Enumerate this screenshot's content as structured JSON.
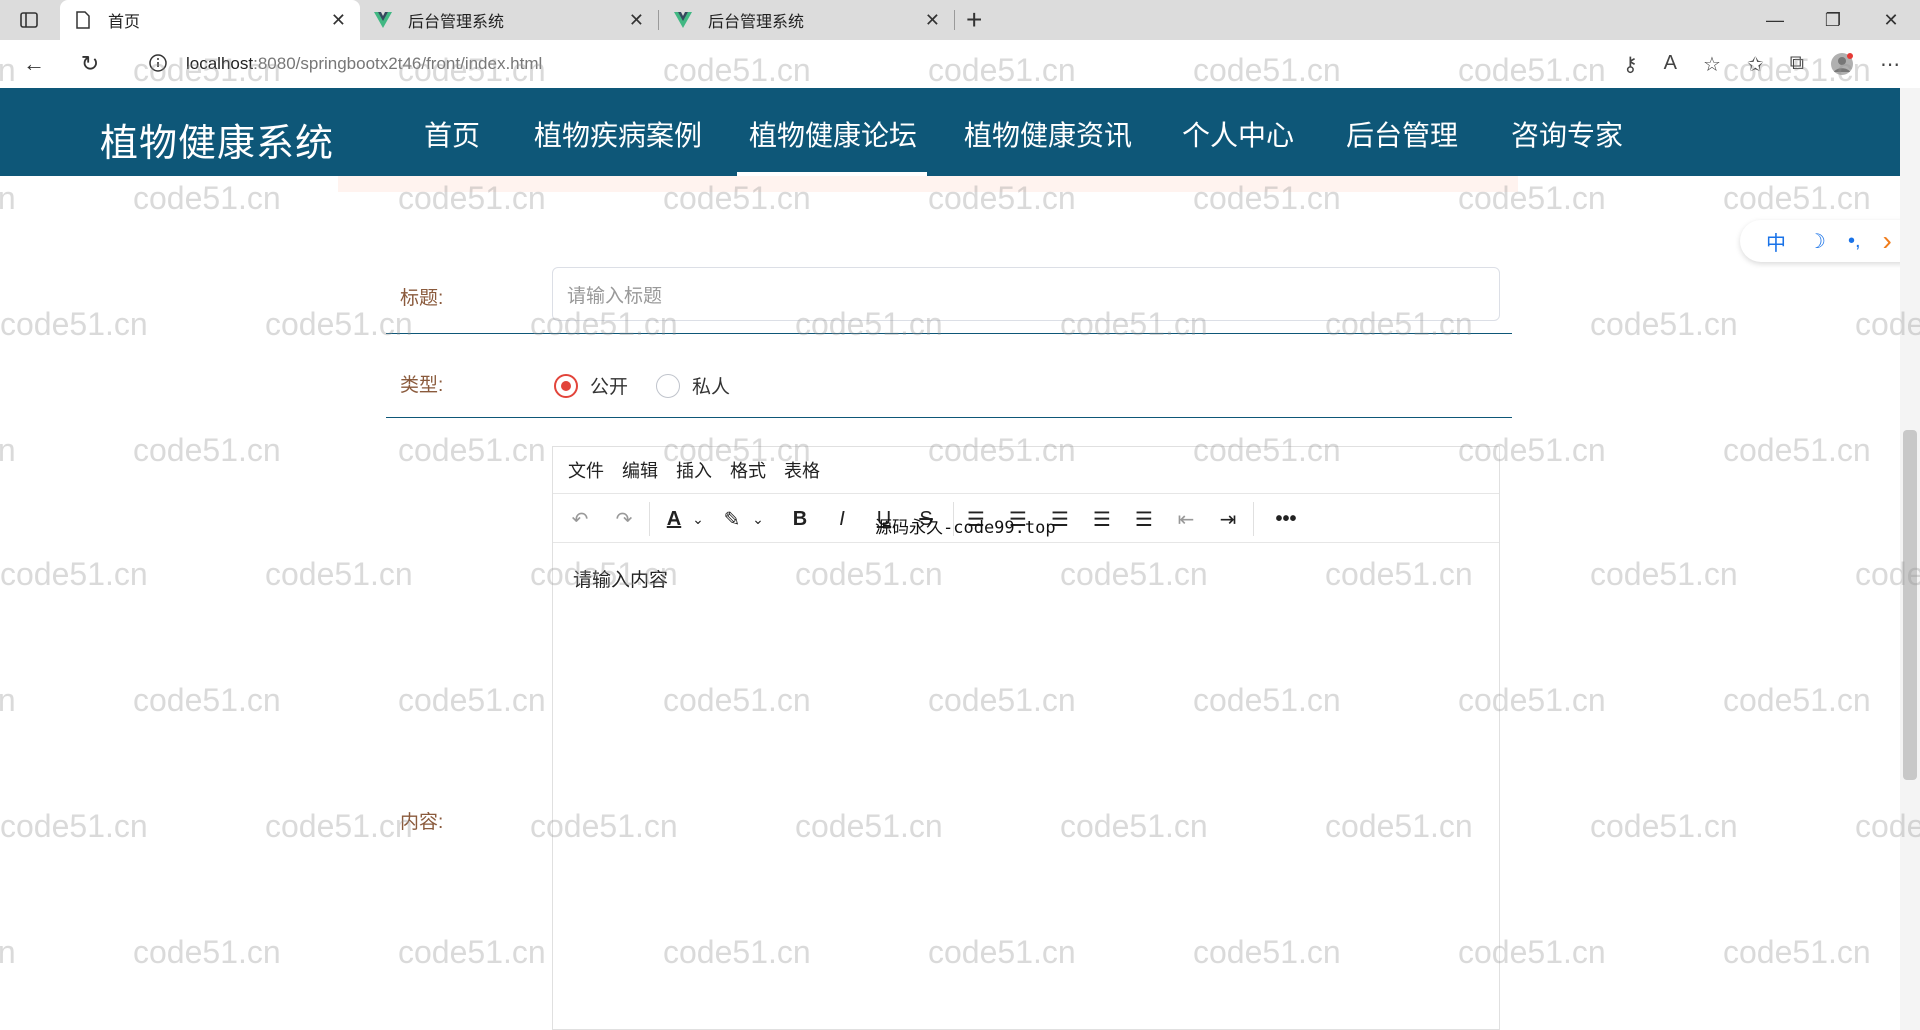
{
  "browser": {
    "tabs": [
      {
        "label": "首页"
      },
      {
        "label": "后台管理系统"
      },
      {
        "label": "后台管理系统"
      }
    ],
    "url_host": "localhost",
    "url_path": ":8080/springbootx2t46/front/index.html"
  },
  "site": {
    "title": "植物健康系统",
    "nav": [
      "首页",
      "植物疾病案例",
      "植物健康论坛",
      "植物健康资讯",
      "个人中心",
      "后台管理",
      "咨询专家"
    ]
  },
  "float_toolbar": [
    "中",
    "☽",
    "•,",
    "›"
  ],
  "form": {
    "title_label": "标题:",
    "title_placeholder": "请输入标题",
    "type_label": "类型:",
    "type_options": [
      "公开",
      "私人"
    ],
    "content_label": "内容:"
  },
  "editor": {
    "menus": [
      "文件",
      "编辑",
      "插入",
      "格式",
      "表格"
    ],
    "content_placeholder": "请输入内容",
    "overlay_text": "源码永久-code99.top"
  },
  "watermark": "code51.cn",
  "colors": {
    "nav_bg": "#0e5778",
    "label": "#8a5a3c",
    "radio_checked": "#e2443a"
  }
}
